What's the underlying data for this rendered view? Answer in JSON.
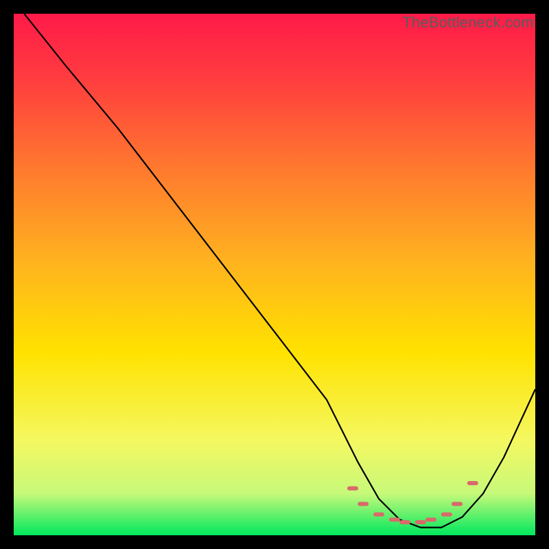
{
  "watermark": "TheBottleneck.com",
  "chart_data": {
    "type": "line",
    "title": "",
    "xlabel": "",
    "ylabel": "",
    "xlim": [
      0,
      100
    ],
    "ylim": [
      0,
      100
    ],
    "grid": false,
    "gradient": {
      "top_color": "#ff1a49",
      "mid_color": "#ffe200",
      "bottom_color": "#00e85e"
    },
    "series": [
      {
        "name": "bottleneck-curve",
        "stroke": "#000000",
        "x": [
          2,
          10,
          20,
          30,
          40,
          50,
          60,
          66,
          70,
          74,
          78,
          82,
          86,
          90,
          94,
          100
        ],
        "y": [
          100,
          90,
          78,
          65,
          52,
          39,
          26,
          14,
          7,
          3,
          1.5,
          1.5,
          3.5,
          8,
          15,
          28
        ]
      },
      {
        "name": "optimal-band-markers",
        "stroke": "#d86a6a",
        "type": "scatter",
        "x": [
          65,
          67,
          70,
          73,
          75,
          78,
          80,
          83,
          85,
          88
        ],
        "y": [
          9,
          6,
          4,
          3,
          2.5,
          2.5,
          3,
          4,
          6,
          10
        ]
      }
    ]
  }
}
